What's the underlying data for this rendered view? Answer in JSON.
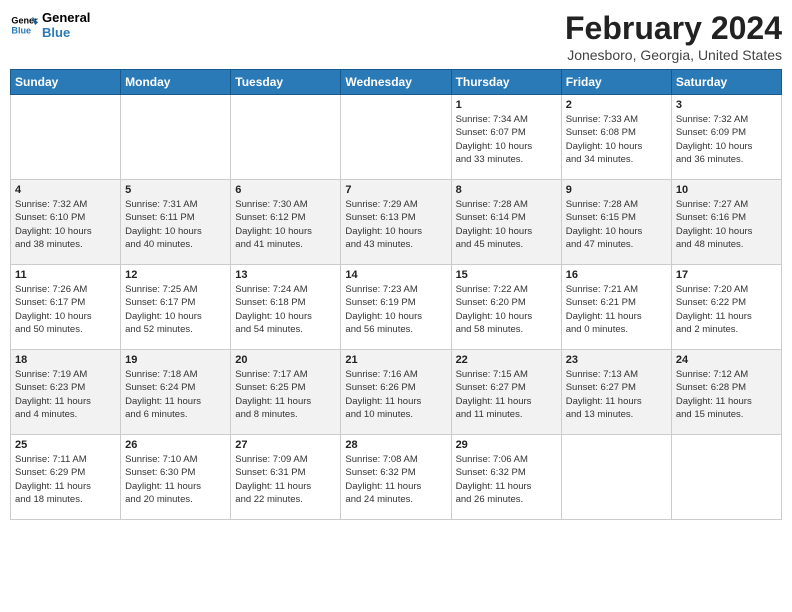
{
  "logo": {
    "line1": "General",
    "line2": "Blue"
  },
  "title": "February 2024",
  "location": "Jonesboro, Georgia, United States",
  "days_of_week": [
    "Sunday",
    "Monday",
    "Tuesday",
    "Wednesday",
    "Thursday",
    "Friday",
    "Saturday"
  ],
  "weeks": [
    [
      {
        "day": "",
        "info": ""
      },
      {
        "day": "",
        "info": ""
      },
      {
        "day": "",
        "info": ""
      },
      {
        "day": "",
        "info": ""
      },
      {
        "day": "1",
        "info": "Sunrise: 7:34 AM\nSunset: 6:07 PM\nDaylight: 10 hours\nand 33 minutes."
      },
      {
        "day": "2",
        "info": "Sunrise: 7:33 AM\nSunset: 6:08 PM\nDaylight: 10 hours\nand 34 minutes."
      },
      {
        "day": "3",
        "info": "Sunrise: 7:32 AM\nSunset: 6:09 PM\nDaylight: 10 hours\nand 36 minutes."
      }
    ],
    [
      {
        "day": "4",
        "info": "Sunrise: 7:32 AM\nSunset: 6:10 PM\nDaylight: 10 hours\nand 38 minutes."
      },
      {
        "day": "5",
        "info": "Sunrise: 7:31 AM\nSunset: 6:11 PM\nDaylight: 10 hours\nand 40 minutes."
      },
      {
        "day": "6",
        "info": "Sunrise: 7:30 AM\nSunset: 6:12 PM\nDaylight: 10 hours\nand 41 minutes."
      },
      {
        "day": "7",
        "info": "Sunrise: 7:29 AM\nSunset: 6:13 PM\nDaylight: 10 hours\nand 43 minutes."
      },
      {
        "day": "8",
        "info": "Sunrise: 7:28 AM\nSunset: 6:14 PM\nDaylight: 10 hours\nand 45 minutes."
      },
      {
        "day": "9",
        "info": "Sunrise: 7:28 AM\nSunset: 6:15 PM\nDaylight: 10 hours\nand 47 minutes."
      },
      {
        "day": "10",
        "info": "Sunrise: 7:27 AM\nSunset: 6:16 PM\nDaylight: 10 hours\nand 48 minutes."
      }
    ],
    [
      {
        "day": "11",
        "info": "Sunrise: 7:26 AM\nSunset: 6:17 PM\nDaylight: 10 hours\nand 50 minutes."
      },
      {
        "day": "12",
        "info": "Sunrise: 7:25 AM\nSunset: 6:17 PM\nDaylight: 10 hours\nand 52 minutes."
      },
      {
        "day": "13",
        "info": "Sunrise: 7:24 AM\nSunset: 6:18 PM\nDaylight: 10 hours\nand 54 minutes."
      },
      {
        "day": "14",
        "info": "Sunrise: 7:23 AM\nSunset: 6:19 PM\nDaylight: 10 hours\nand 56 minutes."
      },
      {
        "day": "15",
        "info": "Sunrise: 7:22 AM\nSunset: 6:20 PM\nDaylight: 10 hours\nand 58 minutes."
      },
      {
        "day": "16",
        "info": "Sunrise: 7:21 AM\nSunset: 6:21 PM\nDaylight: 11 hours\nand 0 minutes."
      },
      {
        "day": "17",
        "info": "Sunrise: 7:20 AM\nSunset: 6:22 PM\nDaylight: 11 hours\nand 2 minutes."
      }
    ],
    [
      {
        "day": "18",
        "info": "Sunrise: 7:19 AM\nSunset: 6:23 PM\nDaylight: 11 hours\nand 4 minutes."
      },
      {
        "day": "19",
        "info": "Sunrise: 7:18 AM\nSunset: 6:24 PM\nDaylight: 11 hours\nand 6 minutes."
      },
      {
        "day": "20",
        "info": "Sunrise: 7:17 AM\nSunset: 6:25 PM\nDaylight: 11 hours\nand 8 minutes."
      },
      {
        "day": "21",
        "info": "Sunrise: 7:16 AM\nSunset: 6:26 PM\nDaylight: 11 hours\nand 10 minutes."
      },
      {
        "day": "22",
        "info": "Sunrise: 7:15 AM\nSunset: 6:27 PM\nDaylight: 11 hours\nand 11 minutes."
      },
      {
        "day": "23",
        "info": "Sunrise: 7:13 AM\nSunset: 6:27 PM\nDaylight: 11 hours\nand 13 minutes."
      },
      {
        "day": "24",
        "info": "Sunrise: 7:12 AM\nSunset: 6:28 PM\nDaylight: 11 hours\nand 15 minutes."
      }
    ],
    [
      {
        "day": "25",
        "info": "Sunrise: 7:11 AM\nSunset: 6:29 PM\nDaylight: 11 hours\nand 18 minutes."
      },
      {
        "day": "26",
        "info": "Sunrise: 7:10 AM\nSunset: 6:30 PM\nDaylight: 11 hours\nand 20 minutes."
      },
      {
        "day": "27",
        "info": "Sunrise: 7:09 AM\nSunset: 6:31 PM\nDaylight: 11 hours\nand 22 minutes."
      },
      {
        "day": "28",
        "info": "Sunrise: 7:08 AM\nSunset: 6:32 PM\nDaylight: 11 hours\nand 24 minutes."
      },
      {
        "day": "29",
        "info": "Sunrise: 7:06 AM\nSunset: 6:32 PM\nDaylight: 11 hours\nand 26 minutes."
      },
      {
        "day": "",
        "info": ""
      },
      {
        "day": "",
        "info": ""
      }
    ]
  ]
}
